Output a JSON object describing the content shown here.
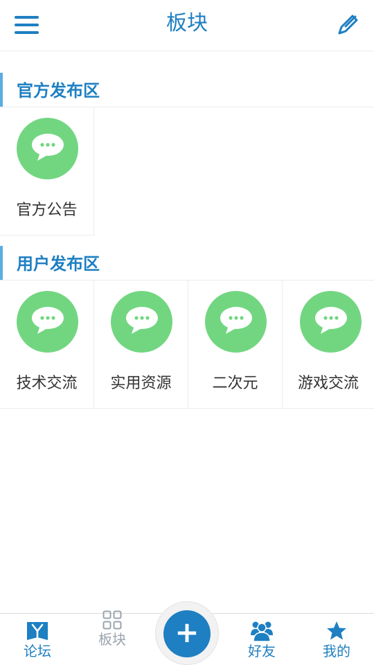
{
  "header": {
    "title": "板块",
    "menu_icon": "menu-icon",
    "edit_icon": "edit-icon"
  },
  "colors": {
    "accent": "#1e7fc2",
    "section_bar": "#5aaee0",
    "icon_bg": "#72d681",
    "inactive": "#9aa3ad"
  },
  "sections": [
    {
      "title": "官方发布区",
      "boards": [
        {
          "name": "官方公告",
          "icon": "chat-bubble-icon"
        }
      ]
    },
    {
      "title": "用户发布区",
      "boards": [
        {
          "name": "技术交流",
          "icon": "chat-bubble-icon"
        },
        {
          "name": "实用资源",
          "icon": "chat-bubble-icon"
        },
        {
          "name": "二次元",
          "icon": "chat-bubble-icon"
        },
        {
          "name": "游戏交流",
          "icon": "chat-bubble-icon"
        }
      ]
    }
  ],
  "bottom_nav": {
    "items": [
      {
        "label": "论坛",
        "icon": "forum-logo-icon",
        "active": true
      },
      {
        "label": "板块",
        "icon": "grid-icon",
        "active": false
      },
      {
        "label": "好友",
        "icon": "friends-icon",
        "active": true
      },
      {
        "label": "我的",
        "icon": "star-icon",
        "active": true
      }
    ],
    "center_button_icon": "plus-icon",
    "center_button_symbol": "+"
  }
}
